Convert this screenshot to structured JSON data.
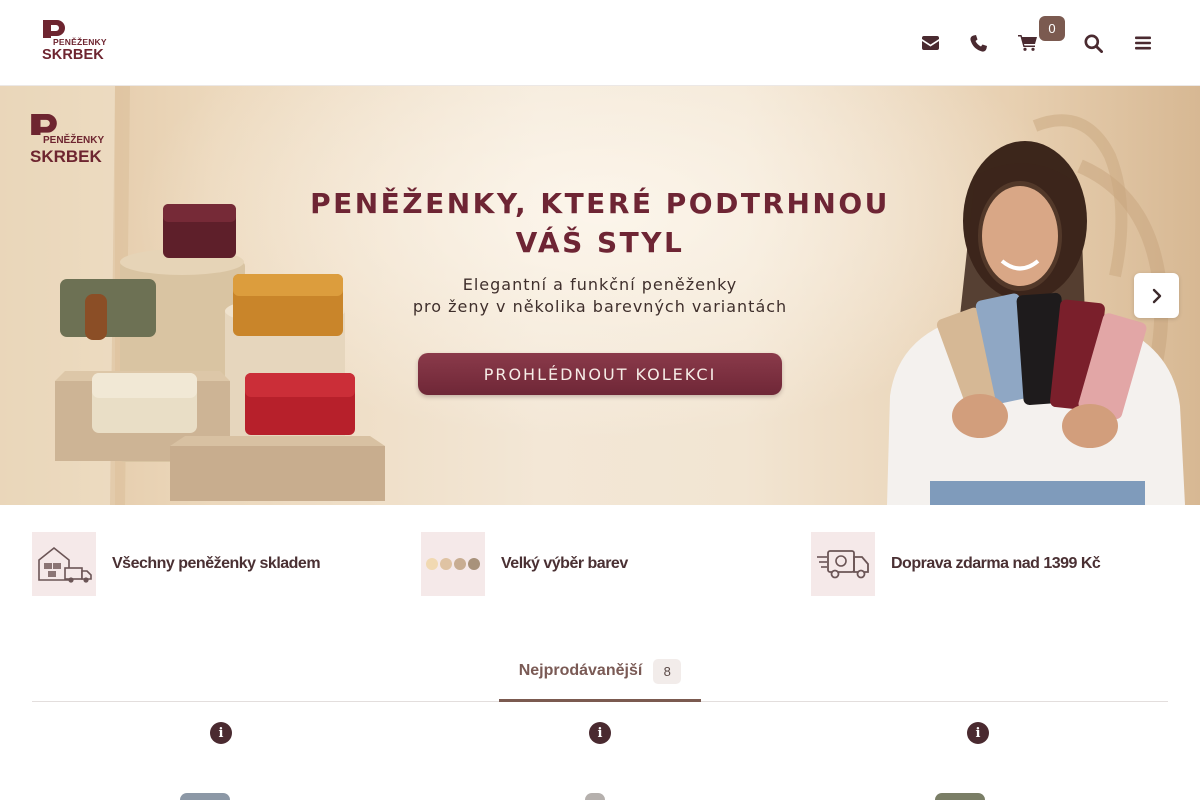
{
  "brand": {
    "logo_top": "PENĚŽENKY",
    "logo_bottom": "SKRBEK",
    "color": "#6e2530"
  },
  "header": {
    "icons": [
      "envelope-icon",
      "phone-icon",
      "cart-icon",
      "search-icon",
      "menu-icon"
    ],
    "cart_count": "0"
  },
  "hero": {
    "title": "PENĚŽENKY, KTERÉ PODTRHNOU\nVÁŠ STYL",
    "subtitle": "Elegantní a funkční peněženky\npro ženy v několika barevných variantách",
    "cta": "PROHLÉDNOUT KOLEKCI",
    "next_icon": "chevron-right-icon"
  },
  "features": [
    {
      "label": "Všechny peněženky skladem",
      "icon": "warehouse-truck-icon"
    },
    {
      "label": "Velký výběr barev",
      "icon": "color-dots-icon"
    },
    {
      "label": "Doprava zdarma nad 1399 Kč",
      "icon": "delivery-truck-icon"
    }
  ],
  "tabs": [
    {
      "label": "Nejprodávanější",
      "count": "8",
      "active": true
    }
  ],
  "colors": {
    "accent": "#7b5a50",
    "wine": "#6e2534",
    "feature_bg": "#f5e9e9"
  }
}
